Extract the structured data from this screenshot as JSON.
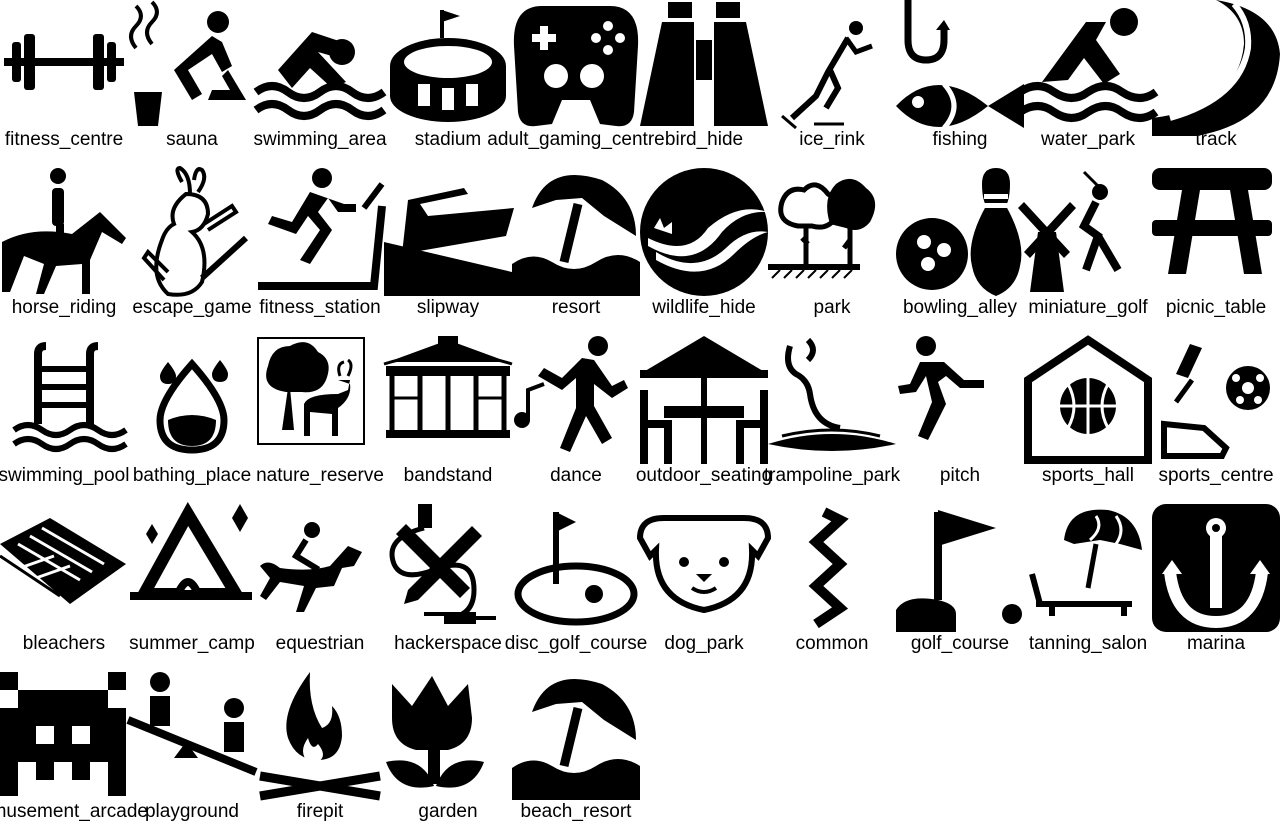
{
  "colors": {
    "background": "#ffffff",
    "icon": "#000000",
    "text": "#000000"
  },
  "icons": [
    {
      "label": "fitness_centre",
      "icon": "barbell-icon"
    },
    {
      "label": "sauna",
      "icon": "sauna-icon"
    },
    {
      "label": "swimming_area",
      "icon": "swimmer-icon"
    },
    {
      "label": "stadium",
      "icon": "stadium-icon"
    },
    {
      "label": "adult_gaming_centre",
      "icon": "gamepad-icon"
    },
    {
      "label": "bird_hide",
      "icon": "binoculars-icon"
    },
    {
      "label": "ice_rink",
      "icon": "ice-skater-icon"
    },
    {
      "label": "fishing",
      "icon": "fish-hook-icon"
    },
    {
      "label": "water_park",
      "icon": "water-slide-icon"
    },
    {
      "label": "track",
      "icon": "running-track-icon"
    },
    {
      "label": "horse_riding",
      "icon": "horse-rider-icon"
    },
    {
      "label": "escape_game",
      "icon": "rabbit-icon"
    },
    {
      "label": "fitness_station",
      "icon": "treadmill-runner-icon"
    },
    {
      "label": "slipway",
      "icon": "boat-ramp-icon"
    },
    {
      "label": "resort",
      "icon": "beach-umbrella-icon"
    },
    {
      "label": "wildlife_hide",
      "icon": "wildlife-emblem-icon"
    },
    {
      "label": "park",
      "icon": "trees-icon"
    },
    {
      "label": "bowling_alley",
      "icon": "bowling-icon"
    },
    {
      "label": "miniature_golf",
      "icon": "windmill-golfer-icon"
    },
    {
      "label": "picnic_table",
      "icon": "picnic-table-icon"
    },
    {
      "label": "swimming_pool",
      "icon": "pool-ladder-icon"
    },
    {
      "label": "bathing_place",
      "icon": "water-drop-icon"
    },
    {
      "label": "nature_reserve",
      "icon": "tree-deer-icon"
    },
    {
      "label": "bandstand",
      "icon": "gazebo-icon"
    },
    {
      "label": "dance",
      "icon": "dancer-note-icon"
    },
    {
      "label": "outdoor_seating",
      "icon": "table-umbrella-icon"
    },
    {
      "label": "trampoline_park",
      "icon": "trampoline-icon"
    },
    {
      "label": "pitch",
      "icon": "running-person-icon"
    },
    {
      "label": "sports_hall",
      "icon": "basketball-house-icon"
    },
    {
      "label": "sports_centre",
      "icon": "sports-equipment-icon"
    },
    {
      "label": "bleachers",
      "icon": "bleachers-icon"
    },
    {
      "label": "summer_camp",
      "icon": "tent-icon"
    },
    {
      "label": "equestrian",
      "icon": "jockey-icon"
    },
    {
      "label": "hackerspace",
      "icon": "tools-icon"
    },
    {
      "label": "disc_golf_course",
      "icon": "flag-green-icon"
    },
    {
      "label": "dog_park",
      "icon": "dog-face-icon"
    },
    {
      "label": "common",
      "icon": "zigzag-icon"
    },
    {
      "label": "golf_course",
      "icon": "golf-flag-icon"
    },
    {
      "label": "tanning_salon",
      "icon": "sun-lounger-icon"
    },
    {
      "label": "marina",
      "icon": "anchor-icon"
    },
    {
      "label": "amusement_arcade",
      "icon": "space-invader-icon"
    },
    {
      "label": "playground",
      "icon": "seesaw-icon"
    },
    {
      "label": "firepit",
      "icon": "campfire-icon"
    },
    {
      "label": "garden",
      "icon": "tulip-icon"
    },
    {
      "label": "beach_resort",
      "icon": "beach-umbrella-icon"
    }
  ]
}
